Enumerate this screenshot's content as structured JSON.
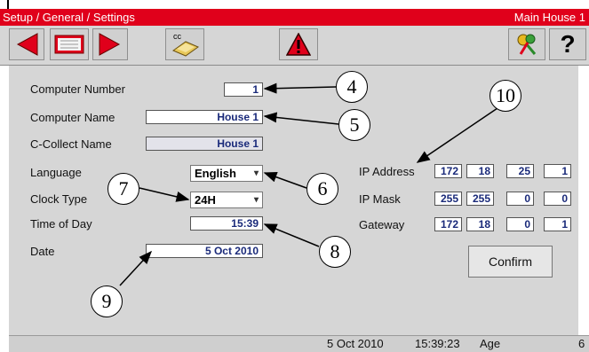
{
  "titlebar": {
    "breadcrumb": "Setup / General / Settings",
    "location": "Main House 1"
  },
  "toolbar": {
    "cc_label": "cc",
    "help_label": "?"
  },
  "form": {
    "computer_number": {
      "label": "Computer Number",
      "value": "1"
    },
    "computer_name": {
      "label": "Computer Name",
      "value": "House 1"
    },
    "c_collect_name": {
      "label": "C-Collect Name",
      "value": "House 1"
    },
    "language": {
      "label": "Language",
      "value": "English"
    },
    "clock_type": {
      "label": "Clock Type",
      "value": "24H"
    },
    "time_of_day": {
      "label": "Time of Day",
      "value": "15:39"
    },
    "date": {
      "label": "Date",
      "value": "5 Oct 2010"
    }
  },
  "network": {
    "ip_address": {
      "label": "IP Address",
      "octets": [
        "172",
        "18",
        "25",
        "1"
      ]
    },
    "ip_mask": {
      "label": "IP Mask",
      "octets": [
        "255",
        "255",
        "0",
        "0"
      ]
    },
    "gateway": {
      "label": "Gateway",
      "octets": [
        "172",
        "18",
        "0",
        "1"
      ]
    },
    "confirm_label": "Confirm"
  },
  "statusbar": {
    "date": "5 Oct 2010",
    "time": "15:39:23",
    "age_label": "Age",
    "age_value": "6"
  },
  "callouts": [
    "4",
    "5",
    "6",
    "7",
    "8",
    "9",
    "10"
  ],
  "colors": {
    "titlebar": "#e0001b",
    "panel": "#d6d6d6",
    "field_text": "#1a2a7a",
    "nav_arrow": "#e0001b"
  }
}
